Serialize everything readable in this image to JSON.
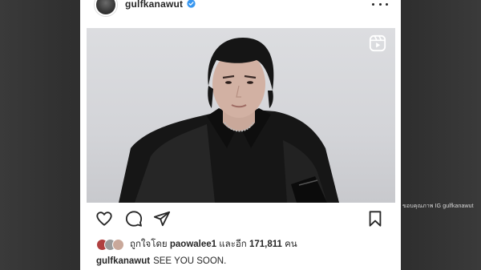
{
  "post": {
    "username": "gulfkanawut",
    "verified": true,
    "more_icon": "more-horizontal-icon",
    "media_type_icon": "reels-icon",
    "image_description_icon": "portrait-photo"
  },
  "actions": {
    "like_icon": "heart-icon",
    "comment_icon": "comment-icon",
    "share_icon": "send-icon",
    "save_icon": "bookmark-icon"
  },
  "likes": {
    "prefix": "ถูกใจโดย",
    "liker": "paowalee1",
    "connector": "และอีก",
    "count": "171,811",
    "suffix": "คน"
  },
  "caption": {
    "username": "gulfkanawut",
    "text": "SEE YOU SOON."
  },
  "watermark": "ขอบคุณภาพ IG gulfkanawut",
  "colors": {
    "verified": "#3897f0",
    "text": "#262626",
    "background": "#2e2e2e"
  }
}
